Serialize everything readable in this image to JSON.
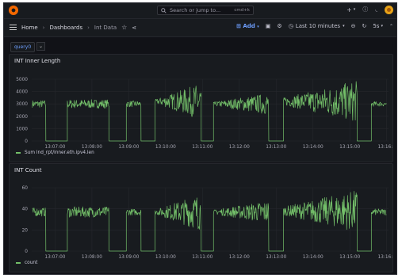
{
  "search": {
    "placeholder": "Search or jump to...",
    "shortcut": "cmd+k"
  },
  "breadcrumb": {
    "home": "Home",
    "dashboards": "Dashboards",
    "current": "Int Data"
  },
  "toolbar": {
    "add_label": "Add",
    "time_range": "Last 10 minutes",
    "refresh": "5s"
  },
  "variables": {
    "query_chip": "query0"
  },
  "colors": {
    "series": "#73bf69",
    "accent": "#6e9fff",
    "background": "#111217",
    "panel": "#181b1f"
  },
  "panels": [
    {
      "title": "INT Inner Length",
      "legend": "Sum Ind_rpt/inner.eth.ipv4.len",
      "chart_data": {
        "type": "line",
        "title": "INT Inner Length",
        "xlabel": "",
        "ylabel": "",
        "y_ticks": [
          "5000",
          "4000",
          "3000",
          "2000",
          "1000",
          "0"
        ],
        "ylim": [
          0,
          5000
        ],
        "x_ticks": [
          "13:07:00",
          "13:08:00",
          "13:09:00",
          "13:10:00",
          "13:11:00",
          "13:12:00",
          "13:13:00",
          "13:14:00",
          "13:15:00",
          "13:16:0"
        ],
        "grid": true,
        "legend_placement": "bottom-left",
        "series": [
          {
            "name": "Sum Ind_rpt/inner.eth.ipv4.len",
            "segments": [
              {
                "time_from": "13:06:23",
                "time_to": "13:06:45",
                "value": 3000,
                "noise": 300
              },
              {
                "time_from": "13:06:45",
                "time_to": "13:07:20",
                "value": 0,
                "noise": 0
              },
              {
                "time_from": "13:07:20",
                "time_to": "13:08:28",
                "value": 3000,
                "noise": 350
              },
              {
                "time_from": "13:08:28",
                "time_to": "13:08:56",
                "value": 0,
                "noise": 0
              },
              {
                "time_from": "13:08:56",
                "time_to": "13:09:20",
                "value": 3000,
                "noise": 250
              },
              {
                "time_from": "13:09:20",
                "time_to": "13:09:43",
                "value": 0,
                "noise": 0
              },
              {
                "time_from": "13:09:43",
                "time_to": "13:10:58",
                "value": 3200,
                "noise_start": 150,
                "noise_end": 1500
              },
              {
                "time_from": "13:10:58",
                "time_to": "13:11:18",
                "value": 0,
                "noise": 0
              },
              {
                "time_from": "13:11:18",
                "time_to": "13:12:48",
                "value": 3000,
                "noise_start": 150,
                "noise_end": 900
              },
              {
                "time_from": "13:12:48",
                "time_to": "13:13:12",
                "value": 0,
                "noise": 0
              },
              {
                "time_from": "13:13:12",
                "time_to": "13:15:12",
                "value": 3200,
                "noise_start": 300,
                "noise_end": 1700
              },
              {
                "time_from": "13:15:12",
                "time_to": "13:15:35",
                "value": 0,
                "noise": 0
              },
              {
                "time_from": "13:15:35",
                "time_to": "13:16:00",
                "value": 3000,
                "noise": 200
              }
            ]
          }
        ]
      }
    },
    {
      "title": "INT Count",
      "legend": "count",
      "chart_data": {
        "type": "line",
        "title": "INT Count",
        "xlabel": "",
        "ylabel": "",
        "y_ticks": [
          "60",
          "40",
          "20",
          "0"
        ],
        "ylim": [
          0,
          60
        ],
        "x_ticks": [
          "13:07:00",
          "13:08:00",
          "13:09:00",
          "13:10:00",
          "13:11:00",
          "13:12:00",
          "13:13:00",
          "13:14:00",
          "13:15:00",
          "13:16:0"
        ],
        "grid": true,
        "legend_placement": "bottom-left",
        "series": [
          {
            "name": "count",
            "segments": [
              {
                "time_from": "13:06:23",
                "time_to": "13:06:45",
                "value": 37,
                "noise": 4
              },
              {
                "time_from": "13:06:45",
                "time_to": "13:07:20",
                "value": 0,
                "noise": 0
              },
              {
                "time_from": "13:07:20",
                "time_to": "13:08:28",
                "value": 37,
                "noise": 5
              },
              {
                "time_from": "13:08:28",
                "time_to": "13:08:56",
                "value": 0,
                "noise": 0
              },
              {
                "time_from": "13:08:56",
                "time_to": "13:09:20",
                "value": 37,
                "noise": 3
              },
              {
                "time_from": "13:09:20",
                "time_to": "13:09:43",
                "value": 0,
                "noise": 0
              },
              {
                "time_from": "13:09:43",
                "time_to": "13:10:58",
                "value": 37,
                "noise_start": 2,
                "noise_end": 18
              },
              {
                "time_from": "13:10:58",
                "time_to": "13:11:18",
                "value": 0,
                "noise": 0
              },
              {
                "time_from": "13:11:18",
                "time_to": "13:12:48",
                "value": 37,
                "noise_start": 2,
                "noise_end": 11
              },
              {
                "time_from": "13:12:48",
                "time_to": "13:13:12",
                "value": 0,
                "noise": 0
              },
              {
                "time_from": "13:13:12",
                "time_to": "13:15:12",
                "value": 38,
                "noise_start": 4,
                "noise_end": 20
              },
              {
                "time_from": "13:15:12",
                "time_to": "13:15:35",
                "value": 0,
                "noise": 0
              },
              {
                "time_from": "13:15:35",
                "time_to": "13:16:00",
                "value": 37,
                "noise": 3
              }
            ]
          }
        ]
      }
    }
  ]
}
